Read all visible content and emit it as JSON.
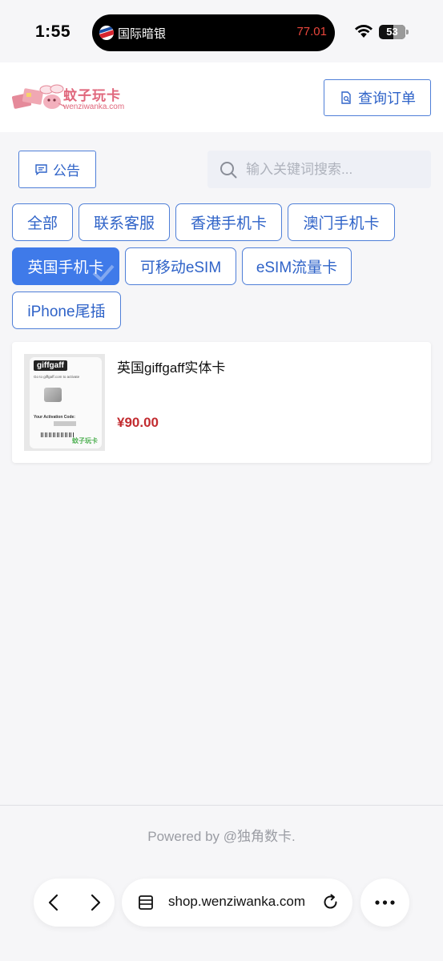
{
  "status_bar": {
    "time": "1:55",
    "island_app": "国际暗银",
    "island_value": "77.01",
    "battery": "53"
  },
  "header": {
    "logo_name": "蚊子玩卡",
    "logo_url": "wenziwanka.com",
    "order_button": "查询订单"
  },
  "toolbar": {
    "notice_button": "公告",
    "search_placeholder": "输入关键词搜索..."
  },
  "categories": [
    {
      "label": "全部",
      "active": false
    },
    {
      "label": "联系客服",
      "active": false
    },
    {
      "label": "香港手机卡",
      "active": false
    },
    {
      "label": "澳门手机卡",
      "active": false
    },
    {
      "label": "英国手机卡",
      "active": true
    },
    {
      "label": "可移动eSIM",
      "active": false
    },
    {
      "label": "eSIM流量卡",
      "active": false
    },
    {
      "label": "iPhone尾插",
      "active": false
    }
  ],
  "products": [
    {
      "title": "英国giffgaff实体卡",
      "price": "¥90.00",
      "image_icon": "giffgaff-sim-card-image",
      "image_text": {
        "brand": "giffgaff",
        "activate_line": "Go to giffgaff.com to activate",
        "activation_label": "Your Activation Code:",
        "watermark": "蚊子玩卡"
      }
    }
  ],
  "footer": {
    "powered_by": "Powered by @独角数卡."
  },
  "browser": {
    "url": "shop.wenziwanka.com"
  },
  "colors": {
    "accent": "#3f7ae9",
    "border": "#4f7fd8",
    "price": "#c22c30",
    "logo": "#e0677c"
  }
}
